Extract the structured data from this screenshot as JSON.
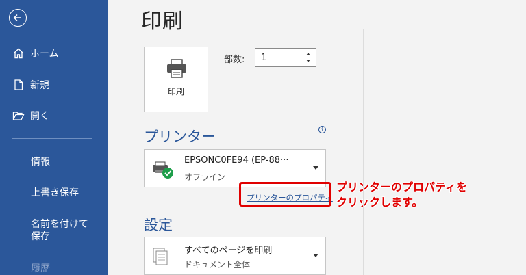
{
  "sidebar": {
    "items": [
      {
        "label": "ホーム",
        "icon": "home-icon"
      },
      {
        "label": "新規",
        "icon": "new-document-icon"
      },
      {
        "label": "開く",
        "icon": "open-folder-icon"
      }
    ],
    "sub_items": [
      {
        "label": "情報"
      },
      {
        "label": "上書き保存"
      },
      {
        "label": "名前を付けて保存"
      },
      {
        "label": "履歴"
      }
    ]
  },
  "main": {
    "title": "印刷",
    "print_button_label": "印刷",
    "copies_label": "部数:",
    "copies_value": "1",
    "printer_section_title": "プリンター",
    "printer": {
      "name": "EPSONC0FE94 (EP-88···",
      "status": "オフライン"
    },
    "printer_properties_link": "プリンターのプロパティ",
    "settings_section_title": "設定",
    "settings_pages": {
      "line1": "すべてのページを印刷",
      "line2": "ドキュメント全体"
    }
  },
  "annotation": {
    "line1": "プリンターのプロパティを",
    "line2": "クリックします。",
    "color": "#e00000"
  },
  "colors": {
    "sidebar_bg": "#2b579a",
    "accent": "#2b579a"
  }
}
